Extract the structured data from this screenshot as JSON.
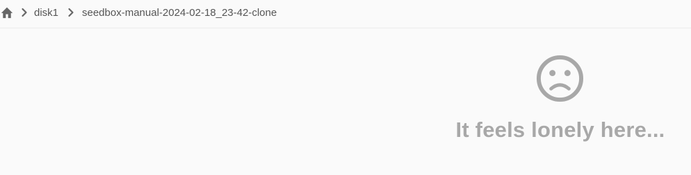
{
  "breadcrumb": {
    "home_icon": "home-icon",
    "separator_icon": "chevron-right-icon",
    "items": [
      "disk1",
      "seedbox-manual-2024-02-18_23-42-clone"
    ]
  },
  "empty_state": {
    "icon": "sentiment-dissatisfied-icon",
    "message": "It feels lonely here..."
  },
  "colors": {
    "background": "#fafafa",
    "breadcrumb_text": "#555555",
    "empty_gray": "#a8a8a8"
  }
}
